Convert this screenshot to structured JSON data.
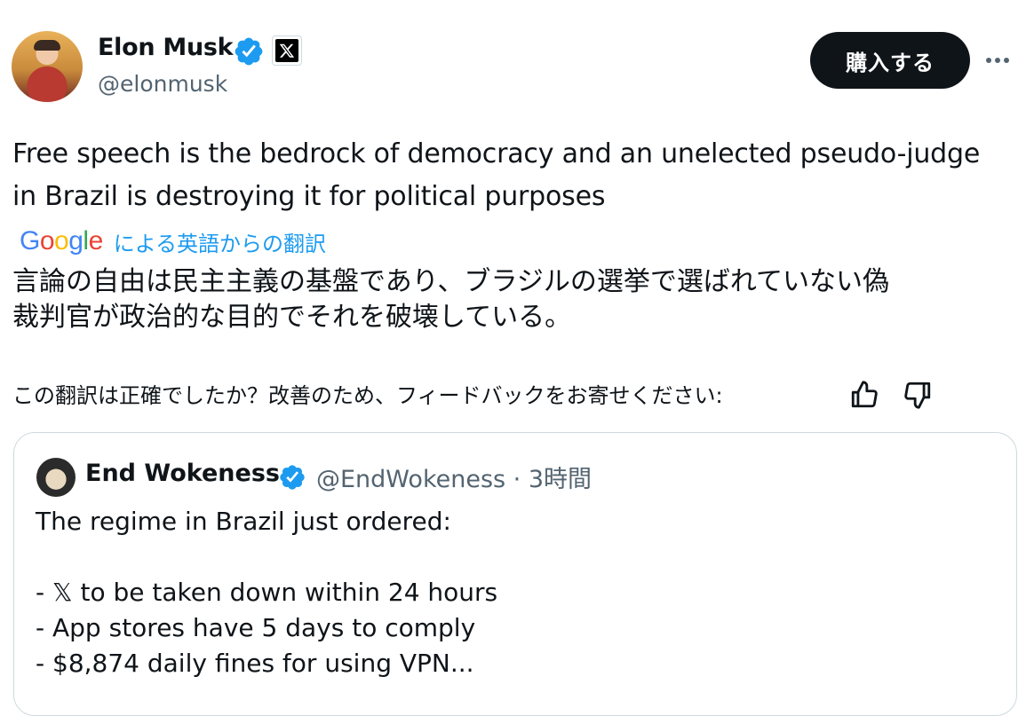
{
  "author": {
    "name": "Elon Musk",
    "handle": "@elonmusk",
    "verified_icon": "verified-badge-icon",
    "affiliation_icon": "x-logo-icon"
  },
  "header": {
    "subscribe_label": "購入する",
    "more_icon": "more-horizontal-icon"
  },
  "tweet": {
    "text": "Free speech is the bedrock of democracy and an unelected pseudo-judge\nin Brazil is destroying it for political purposes",
    "translation_label": "による英語からの翻訳",
    "translated_text": "言論の自由は民主主義の基盤であり、ブラジルの選挙で選ばれていない偽\n裁判官が政治的な目的でそれを破壊している。",
    "feedback_prompt": "この翻訳は正確でしたか？改善のため、フィードバックをお寄せください:"
  },
  "google_logo": [
    "G",
    "o",
    "o",
    "g",
    "l",
    "e"
  ],
  "quoted": {
    "name": "End Wokeness",
    "meta": "@EndWokeness · 3時間",
    "body": "The regime in Brazil just ordered:\n\n- 𝕏 to be taken down within 24 hours\n- App stores have 5 days to comply\n- $8,874 daily fines for using VPN..."
  },
  "colors": {
    "accent": "#1d9bf0",
    "text": "#0f1419",
    "secondary": "#536471",
    "border": "#cfd9de"
  }
}
